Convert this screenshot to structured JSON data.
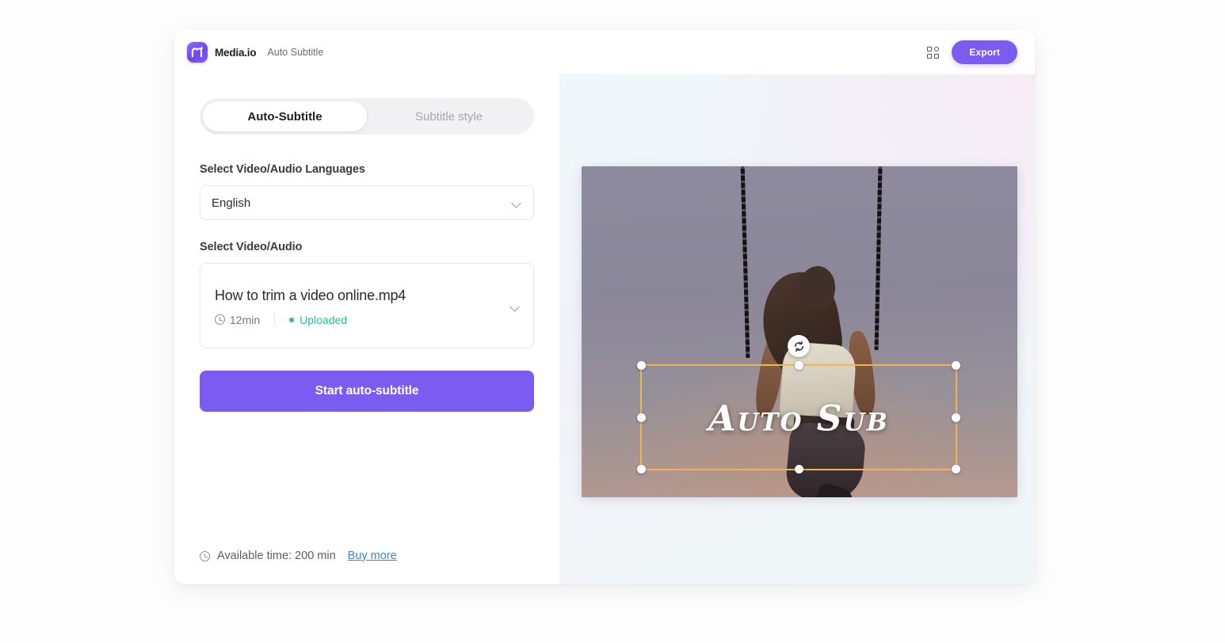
{
  "header": {
    "brand_name": "Media.io",
    "page_label": "Auto Subtitle",
    "logo_icon": "media-io-logo-icon",
    "grid_icon": "apps-grid-icon",
    "export_label": "Export"
  },
  "tabs": [
    {
      "label": "Auto-Subtitle",
      "active": true
    },
    {
      "label": "Subtitle style",
      "active": false
    }
  ],
  "language_section": {
    "label": "Select Video/Audio Languages",
    "selected": "English",
    "chevron_icon": "chevron-down-icon"
  },
  "media_section": {
    "label": "Select Video/Audio",
    "file_name": "How to trim a video online.mp4",
    "duration": "12min",
    "duration_icon": "clock-icon",
    "status": "Uploaded",
    "status_color": "#25c191",
    "chevron_icon": "chevron-down-icon"
  },
  "action": {
    "start_label": "Start auto-subtitle",
    "accent_color": "#7b5cf0"
  },
  "footer": {
    "clock_icon": "clock-icon",
    "available_time": "Available time: 200 min",
    "buy_more": "Buy more",
    "link_color": "#3b86d8"
  },
  "preview": {
    "subtitle_overlay_text": "Auto Sub",
    "selection_color": "#f0b450",
    "rotate_icon": "rotate-icon",
    "handle_count": 8
  }
}
